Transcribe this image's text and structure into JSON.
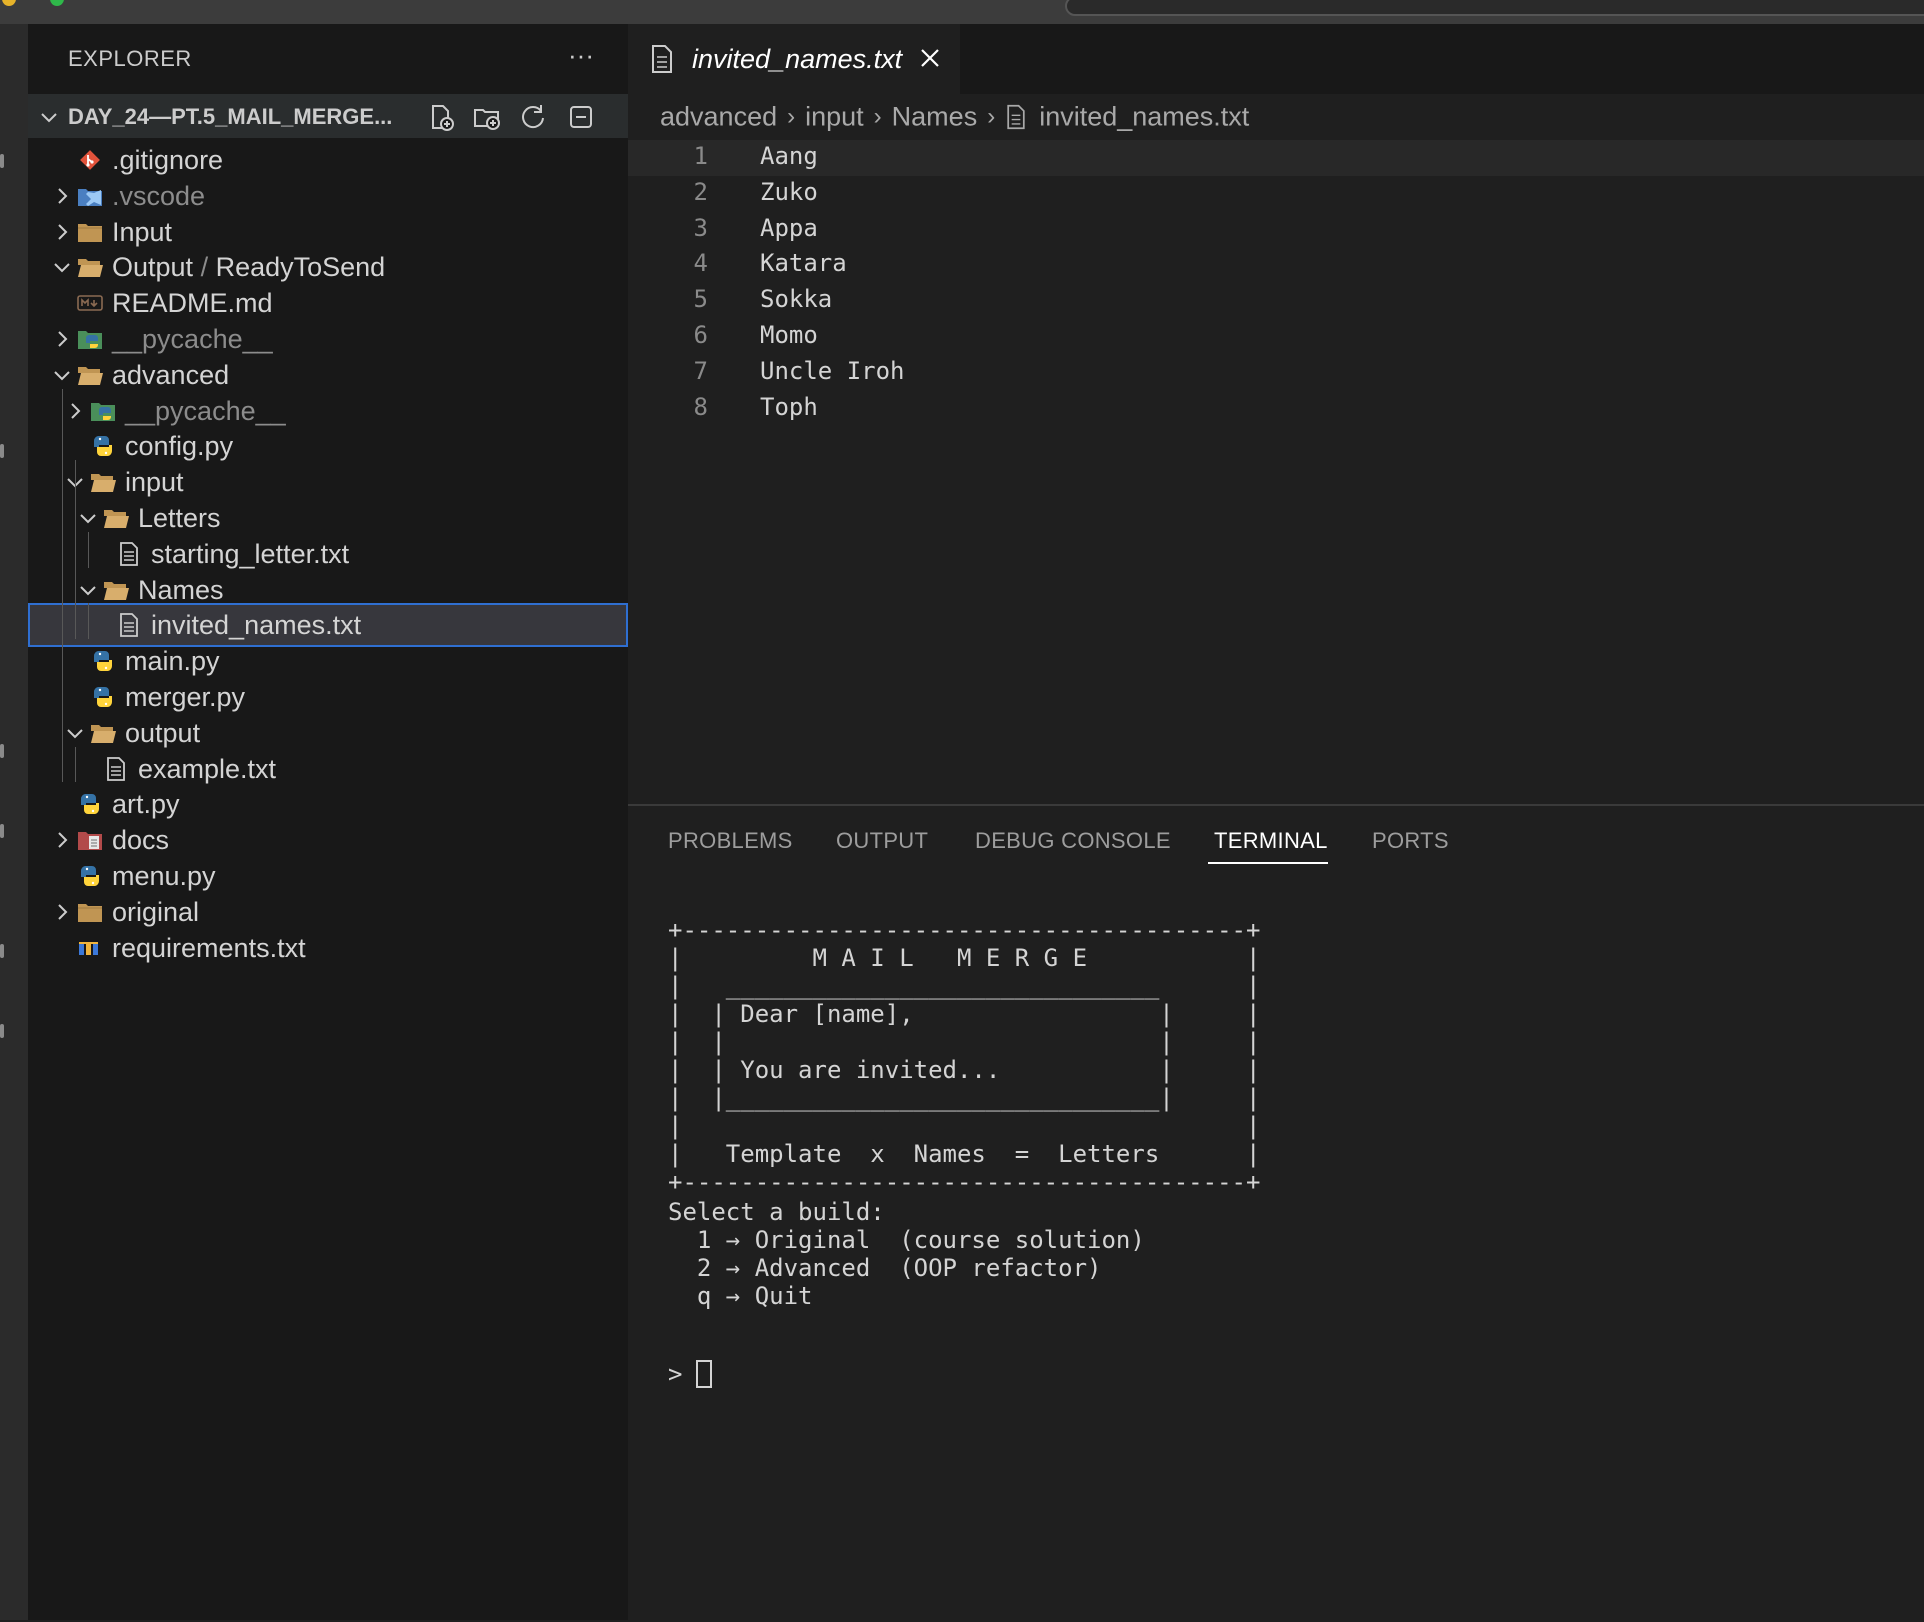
{
  "explorer": {
    "title": "EXPLORER",
    "more": "···",
    "project": "DAY_24—PT.5_MAIL_MERGE..."
  },
  "tree": [
    {
      "label": ".gitignore",
      "icon": "git-icon",
      "depth": 0,
      "chevron": "none"
    },
    {
      "label": ".vscode",
      "icon": "vscode-folder-icon",
      "depth": 0,
      "chevron": "right",
      "dim": true
    },
    {
      "label": "Input",
      "icon": "folder-icon",
      "depth": 0,
      "chevron": "right"
    },
    {
      "label": "Output",
      "label2": "ReadyToSend",
      "icon": "folder-open-icon",
      "depth": 0,
      "chevron": "down"
    },
    {
      "label": "README.md",
      "icon": "markdown-icon",
      "depth": 0,
      "chevron": "none"
    },
    {
      "label": "__pycache__",
      "icon": "python-folder-icon",
      "depth": 0,
      "chevron": "right",
      "dim": true
    },
    {
      "label": "advanced",
      "icon": "folder-open-icon",
      "depth": 0,
      "chevron": "down"
    },
    {
      "label": "__pycache__",
      "icon": "python-folder-icon",
      "depth": 1,
      "chevron": "right",
      "dim": true
    },
    {
      "label": "config.py",
      "icon": "python-icon",
      "depth": 1,
      "chevron": "none"
    },
    {
      "label": "input",
      "icon": "folder-open-icon",
      "depth": 1,
      "chevron": "down"
    },
    {
      "label": "Letters",
      "icon": "folder-open-icon",
      "depth": 2,
      "chevron": "down"
    },
    {
      "label": "starting_letter.txt",
      "icon": "text-file-icon",
      "depth": 3,
      "chevron": "none"
    },
    {
      "label": "Names",
      "icon": "folder-open-icon",
      "depth": 2,
      "chevron": "down"
    },
    {
      "label": "invited_names.txt",
      "icon": "text-file-icon",
      "depth": 3,
      "chevron": "none",
      "selected": true
    },
    {
      "label": "main.py",
      "icon": "python-icon",
      "depth": 1,
      "chevron": "none"
    },
    {
      "label": "merger.py",
      "icon": "python-icon",
      "depth": 1,
      "chevron": "none"
    },
    {
      "label": "output",
      "icon": "folder-open-icon",
      "depth": 1,
      "chevron": "down"
    },
    {
      "label": "example.txt",
      "icon": "text-file-icon",
      "depth": 2,
      "chevron": "none"
    },
    {
      "label": "art.py",
      "icon": "python-icon",
      "depth": 0,
      "chevron": "none"
    },
    {
      "label": "docs",
      "icon": "docs-folder-icon",
      "depth": 0,
      "chevron": "right"
    },
    {
      "label": "menu.py",
      "icon": "python-icon",
      "depth": 0,
      "chevron": "none"
    },
    {
      "label": "original",
      "icon": "folder-icon",
      "depth": 0,
      "chevron": "right"
    },
    {
      "label": "requirements.txt",
      "icon": "requirements-icon",
      "depth": 0,
      "chevron": "none"
    }
  ],
  "editor": {
    "tab_label": "invited_names.txt",
    "breadcrumb": [
      "advanced",
      "input",
      "Names",
      "invited_names.txt"
    ],
    "lines": [
      "Aang",
      "Zuko",
      "Appa",
      "Katara",
      "Sokka",
      "Momo",
      "Uncle Iroh",
      "Toph"
    ]
  },
  "panel": {
    "tabs": [
      "PROBLEMS",
      "OUTPUT",
      "DEBUG CONSOLE",
      "TERMINAL",
      "PORTS"
    ],
    "active_tab": "TERMINAL",
    "banner": "+---------------------------------------+\n|         M A I L   M E R G E           |\n|   ______________________________      |\n|  | Dear [name],                 |     |\n|  |                              |     |\n|  | You are invited...           |     |\n|  |______________________________|     |\n|                                       |\n|   Template  x  Names  =  Letters      |\n+---------------------------------------+",
    "menu": "Select a build:\n  1 → Original  (course solution)\n  2 → Advanced  (OOP refactor)\n  q → Quit",
    "prompt": ">"
  },
  "colors": {
    "sidebar_bg": "#181818",
    "editor_bg": "#1f1f1f",
    "selection_border": "#2f6fd1",
    "folder": "#c09553",
    "python_blue": "#3572a5",
    "python_yellow": "#ffd43b"
  }
}
